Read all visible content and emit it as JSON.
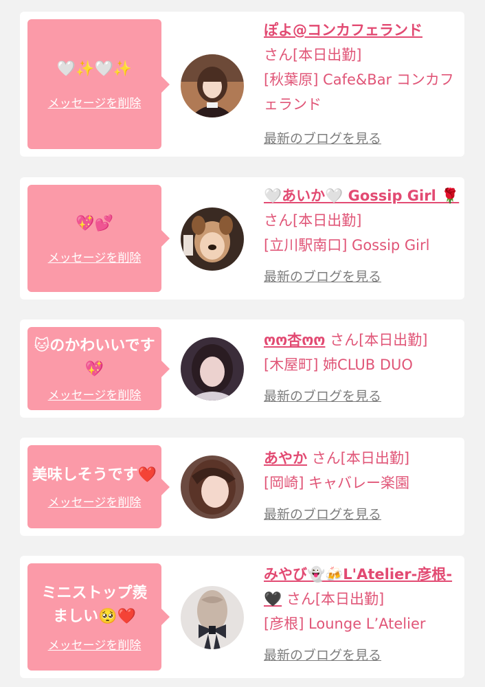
{
  "posts": [
    {
      "message": "🤍✨🤍✨",
      "delete_label": "メッセージを削除",
      "cast_name": "ぽよ@コンカフェランド",
      "san": "さん[本日出勤]",
      "shop": "[秋葉原] Cafe&Bar コンカフェランド",
      "blog_label": "最新のブログを見る",
      "avatar": "girl-with-bangs-photo"
    },
    {
      "message": "💖💕",
      "delete_label": "メッセージを削除",
      "cast_name": "🤍あいか🤍 Gossip Girl 🌹",
      "san": "さん[本日出勤]",
      "shop": "[立川駅南口] Gossip Girl",
      "blog_label": "最新のブログを見る",
      "avatar": "dog-filter-selfie-photo"
    },
    {
      "message": "🐱のかわいいです💖",
      "delete_label": "メッセージを削除",
      "cast_name": "ოო杏ოო",
      "san": "さん[本日出勤]",
      "shop": "[木屋町] 姉CLUB DUO",
      "blog_label": "最新のブログを見る",
      "avatar": "woman-portrait-photo"
    },
    {
      "message": "美味しそうです❤️",
      "delete_label": "メッセージを削除",
      "cast_name": "あやか",
      "san": "さん[本日出勤]",
      "shop": "[岡崎] キャバレー楽園",
      "blog_label": "最新のブログを見る",
      "avatar": "woman-closeup-photo"
    },
    {
      "message": "ミニストップ羨ましい🥺❤️",
      "delete_label": "メッセージを削除",
      "cast_name": "みやび👻🍻L'Atelier-彦根-🖤",
      "san": "さん[本日出勤]",
      "shop": "[彦根] Lounge L’Atelier",
      "blog_label": "最新のブログを見る",
      "avatar": "hair-bow-photo"
    }
  ],
  "colors": {
    "bubble": "#fb9aa8",
    "name": "#e24a72",
    "link": "#7d7d7d",
    "background": "#f2f2f2"
  }
}
